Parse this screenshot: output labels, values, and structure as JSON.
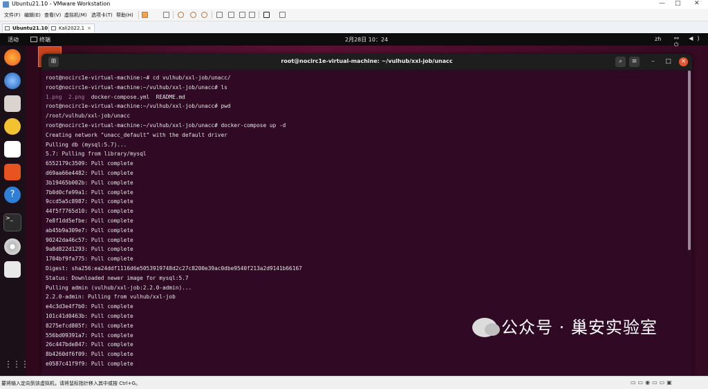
{
  "vmware": {
    "title": "Ubuntu21.10 - VMware Workstation",
    "window_controls": [
      "—",
      "□",
      "✕"
    ],
    "menu": [
      "文件(F)",
      "编辑(E)",
      "查看(V)",
      "虚拟机(M)",
      "选项卡(T)",
      "帮助(H)"
    ],
    "tabs": [
      {
        "label": "Ubuntu21.10",
        "close": "×"
      },
      {
        "label": "Kali2022.1",
        "close": "×"
      }
    ],
    "status_text": "要将输入定向到该虚拟机，请将鼠标指针移入其中或按 Ctrl+G。"
  },
  "ubuntu": {
    "activities": "活动",
    "topbar_app": "终端",
    "clock": "2月28日  10：24",
    "lang": "zh",
    "system_icons": "⚯ ◀) ⏻"
  },
  "terminal": {
    "title": "root@nocirc1e-virtual-machine: ~/vulhub/xxl-job/unacc",
    "lines": [
      {
        "text": "root@nocirc1e-virtual-machine:~# cd vulhub/xxl-job/unacc/",
        "style": "c2"
      },
      {
        "text": "root@nocirc1e-virtual-machine:~/vulhub/xxl-job/unacc# ls",
        "style": "c2"
      },
      {
        "text": "1.png  2.png",
        "style": "c1",
        "rest": "  docker-compose.yml  README.md"
      },
      {
        "text": "root@nocirc1e-virtual-machine:~/vulhub/xxl-job/unacc# pwd",
        "style": "c2"
      },
      {
        "text": "/root/vulhub/xxl-job/unacc",
        "style": "c2"
      },
      {
        "text": "root@nocirc1e-virtual-machine:~/vulhub/xxl-job/unacc# docker-compose up -d",
        "style": "c2"
      },
      {
        "text": "Creating network \"unacc_default\" with the default driver",
        "style": "c2"
      },
      {
        "text": "Pulling db (mysql:5.7)...",
        "style": "c2"
      },
      {
        "text": "5.7: Pulling from library/mysql",
        "style": "c2"
      },
      {
        "text": "6552179c3509: Pull complete",
        "style": "c2"
      },
      {
        "text": "d69aa66e4482: Pull complete",
        "style": "c2"
      },
      {
        "text": "3b19465b002b: Pull complete",
        "style": "c2"
      },
      {
        "text": "7b0d0cfe99a1: Pull complete",
        "style": "c2"
      },
      {
        "text": "9ccd5a5c8987: Pull complete",
        "style": "c2"
      },
      {
        "text": "44f5f7765d10: Pull complete",
        "style": "c2"
      },
      {
        "text": "7e8f1dd5efbe: Pull complete",
        "style": "c2"
      },
      {
        "text": "ab45b9a309e7: Pull complete",
        "style": "c2"
      },
      {
        "text": "90242da46c57: Pull complete",
        "style": "c2"
      },
      {
        "text": "9a8d822d1293: Pull complete",
        "style": "c2"
      },
      {
        "text": "1704bf9fa775: Pull complete",
        "style": "c2"
      },
      {
        "text": "Digest: sha256:ea24ddf1116d6e5053919748d2c27c8200e39ac0dbe9540f213a2d9141b66167",
        "style": "c2"
      },
      {
        "text": "Status: Downloaded newer image for mysql:5.7",
        "style": "c2"
      },
      {
        "text": "Pulling admin (vulhub/xxl-job:2.2.0-admin)...",
        "style": "c2"
      },
      {
        "text": "2.2.0-admin: Pulling from vulhub/xxl-job",
        "style": "c2"
      },
      {
        "text": "e4c3d3e4f7b0: Pull complete",
        "style": "c2"
      },
      {
        "text": "101c41d0463b: Pull complete",
        "style": "c2"
      },
      {
        "text": "8275efcd805f: Pull complete",
        "style": "c2"
      },
      {
        "text": "556bd09391a7: Pull complete",
        "style": "c2"
      },
      {
        "text": "26c447bde847: Pull complete",
        "style": "c2"
      },
      {
        "text": "8b4260df6f09: Pull complete",
        "style": "c2"
      },
      {
        "text": "e0587c41f9f9: Pull complete",
        "style": "c2"
      }
    ]
  },
  "watermark": "公众号 · 巢安实验室",
  "colors": {
    "terminal_bg": "#300a24",
    "terminal_header": "#1e1e1e",
    "close_button": "#e9542c",
    "ls_file_color": "#ad7fa8"
  }
}
